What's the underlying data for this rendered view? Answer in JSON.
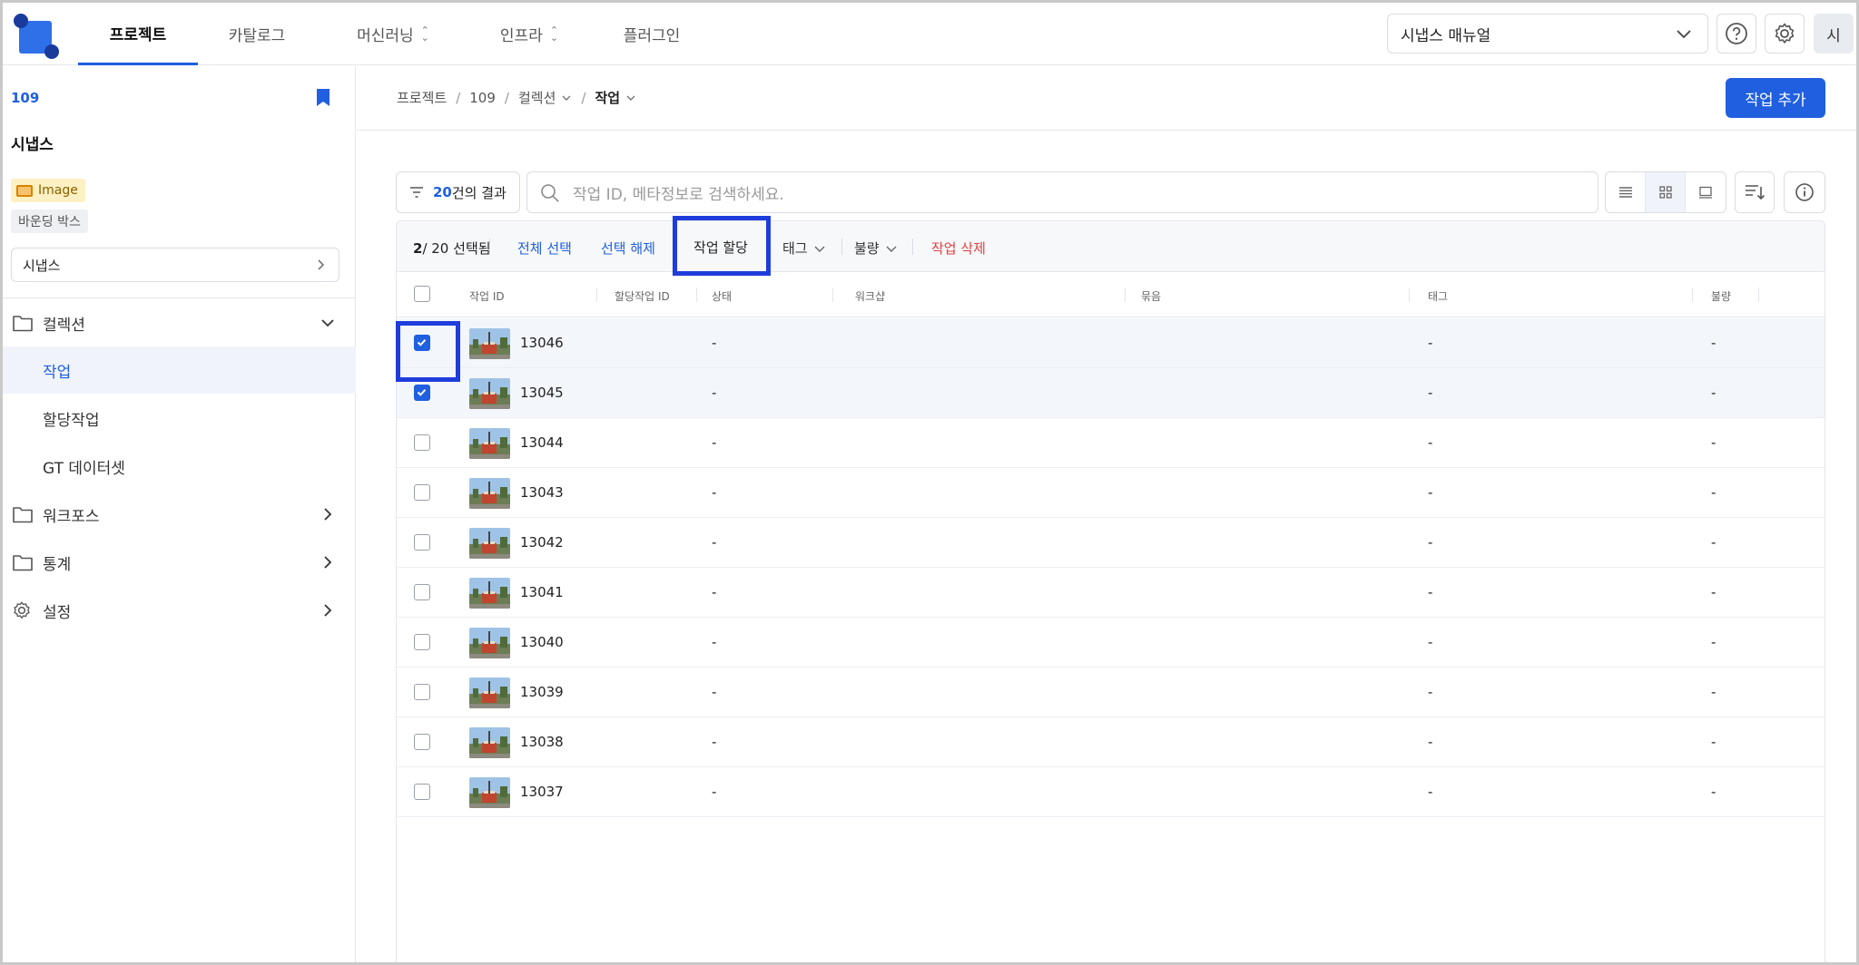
{
  "topnav": {
    "tabs": [
      {
        "label": "프로젝트",
        "active": true
      },
      {
        "label": "카탈로그"
      },
      {
        "label": "머신러닝",
        "has_dropdown": true
      },
      {
        "label": "인프라",
        "has_dropdown": true
      },
      {
        "label": "플러그인"
      }
    ],
    "manual_select": "시냅스 매뉴얼",
    "avatar": "시"
  },
  "sidebar": {
    "project_id": "109",
    "project_name": "시냅스",
    "badge_type": "Image",
    "badge_annotation": "바운딩 박스",
    "dataset_select": "시냅스",
    "items": {
      "collection": "컬렉션",
      "job": "작업",
      "assigned_job": "할당작업",
      "gt_dataset": "GT 데이터셋",
      "workforce": "워크포스",
      "stats": "통계",
      "settings": "설정"
    }
  },
  "main": {
    "breadcrumb": [
      "프로젝트",
      "109",
      "컬렉션",
      "작업"
    ],
    "add_job_button": "작업 추가",
    "filter_count": "20",
    "filter_label": "건의 결과",
    "search_placeholder": "작업 ID, 메타정보로 검색하세요."
  },
  "toolbar": {
    "selected": "2",
    "total": "/ 20",
    "selected_label": "선택됨",
    "select_all": "전체 선택",
    "deselect": "선택 해제",
    "assign": "작업 할당",
    "tag": "태그",
    "defect": "불량",
    "delete": "작업 삭제"
  },
  "table": {
    "headers": [
      "작업 ID",
      "할당작업 ID",
      "상태",
      "워크샵",
      "묶음",
      "태그",
      "불량"
    ],
    "rows": [
      {
        "id": "13046",
        "status": "-",
        "tag": "-",
        "defect": "-",
        "checked": true
      },
      {
        "id": "13045",
        "status": "-",
        "tag": "-",
        "defect": "-",
        "checked": true
      },
      {
        "id": "13044",
        "status": "-",
        "tag": "-",
        "defect": "-",
        "checked": false
      },
      {
        "id": "13043",
        "status": "-",
        "tag": "-",
        "defect": "-",
        "checked": false
      },
      {
        "id": "13042",
        "status": "-",
        "tag": "-",
        "defect": "-",
        "checked": false
      },
      {
        "id": "13041",
        "status": "-",
        "tag": "-",
        "defect": "-",
        "checked": false
      },
      {
        "id": "13040",
        "status": "-",
        "tag": "-",
        "defect": "-",
        "checked": false
      },
      {
        "id": "13039",
        "status": "-",
        "tag": "-",
        "defect": "-",
        "checked": false
      },
      {
        "id": "13038",
        "status": "-",
        "tag": "-",
        "defect": "-",
        "checked": false
      },
      {
        "id": "13037",
        "status": "-",
        "tag": "-",
        "defect": "-",
        "checked": false
      }
    ]
  },
  "colors": {
    "accent": "#1f5fe0",
    "highlight": "#1e3ddc",
    "danger": "#e04040",
    "badge_bg": "#fdf0c2"
  }
}
